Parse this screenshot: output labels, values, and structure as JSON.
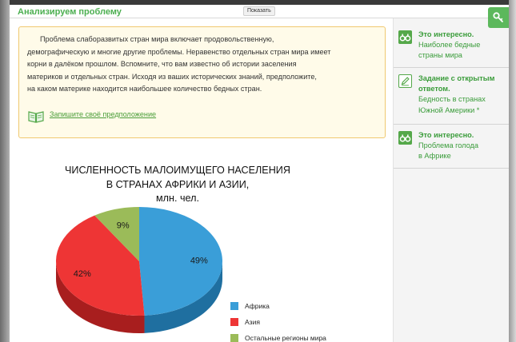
{
  "section": {
    "title": "Анализируем проблему",
    "show_button": "Показать"
  },
  "task": {
    "lines": [
      "Проблема слаборазвитых стран мира включает продовольственную,",
      "демографическую и многие другие проблемы. Неравенство отдельных стран мира имеет",
      "корни в далёком прошлом. Вспомните, что вам известно об истории заселения",
      "материков и отдельных стран. Исходя из ваших исторических знаний, предположите,",
      "на каком материке находится наибольшее количество бедных стран."
    ],
    "link_label": "Запишите своё предположение"
  },
  "sidebar": {
    "items": [
      {
        "title": "Это интересно.",
        "body_lines": [
          "Наиболее бедные",
          "страны мира"
        ],
        "icon": "binoculars-icon"
      },
      {
        "title_lines": [
          "Задание с открытым",
          "ответом."
        ],
        "body_lines": [
          "Бедность в странах",
          "Южной Америки *"
        ],
        "icon": "pencil-icon"
      },
      {
        "title": "Это интересно.",
        "body_lines": [
          "Проблема голода",
          "в Африке"
        ],
        "icon": "binoculars-icon"
      }
    ]
  },
  "chart_data": {
    "type": "pie",
    "title_lines": [
      "ЧИСЛЕННОСТЬ МАЛОИМУЩЕГО НАСЕЛЕНИЯ",
      "В СТРАНАХ АФРИКИ И АЗИИ,",
      "млн. чел."
    ],
    "slices": [
      {
        "name": "Африка",
        "value": 49,
        "label": "49%",
        "color": "#3a9ed8",
        "side_color": "#1f6fa0"
      },
      {
        "name": "Азия",
        "value": 42,
        "label": "42%",
        "color": "#ee3535",
        "side_color": "#a81e1e"
      },
      {
        "name": "Остальные регионы мира",
        "value": 9,
        "label": "9%",
        "color": "#9bbb59",
        "side_color": "#6d8a3a"
      }
    ]
  },
  "colors": {
    "accent": "#4caf50",
    "task_border": "#f0c870",
    "task_bg": "#fffbe9"
  }
}
